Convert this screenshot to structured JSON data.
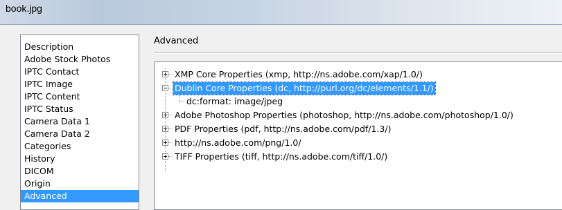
{
  "window": {
    "title": "book.jpg"
  },
  "categories": [
    {
      "label": "Description",
      "selected": false
    },
    {
      "label": "Adobe Stock Photos",
      "selected": false
    },
    {
      "label": "IPTC Contact",
      "selected": false
    },
    {
      "label": "IPTC Image",
      "selected": false
    },
    {
      "label": "IPTC Content",
      "selected": false
    },
    {
      "label": "IPTC Status",
      "selected": false
    },
    {
      "label": "Camera Data 1",
      "selected": false
    },
    {
      "label": "Camera Data 2",
      "selected": false
    },
    {
      "label": "Categories",
      "selected": false
    },
    {
      "label": "History",
      "selected": false
    },
    {
      "label": "DICOM",
      "selected": false
    },
    {
      "label": "Origin",
      "selected": false
    },
    {
      "label": "Advanced",
      "selected": true
    }
  ],
  "panel": {
    "heading": "Advanced",
    "tree": [
      {
        "label": "XMP Core Properties (xmp, http://ns.adobe.com/xap/1.0/)",
        "expanded": false,
        "selected": false
      },
      {
        "label": "Dublin Core Properties (dc, http://purl.org/dc/elements/1.1/)",
        "expanded": true,
        "selected": true
      },
      {
        "label": "dc:format: image/jpeg",
        "child": true
      },
      {
        "label": "Adobe Photoshop Properties (photoshop, http://ns.adobe.com/photoshop/1.0/)",
        "expanded": false,
        "selected": false
      },
      {
        "label": "PDF Properties (pdf, http://ns.adobe.com/pdf/1.3/)",
        "expanded": false,
        "selected": false
      },
      {
        "label": "http://ns.adobe.com/png/1.0/",
        "expanded": false,
        "selected": false
      },
      {
        "label": "TIFF Properties (tiff, http://ns.adobe.com/tiff/1.0/)",
        "expanded": false,
        "selected": false
      }
    ]
  }
}
